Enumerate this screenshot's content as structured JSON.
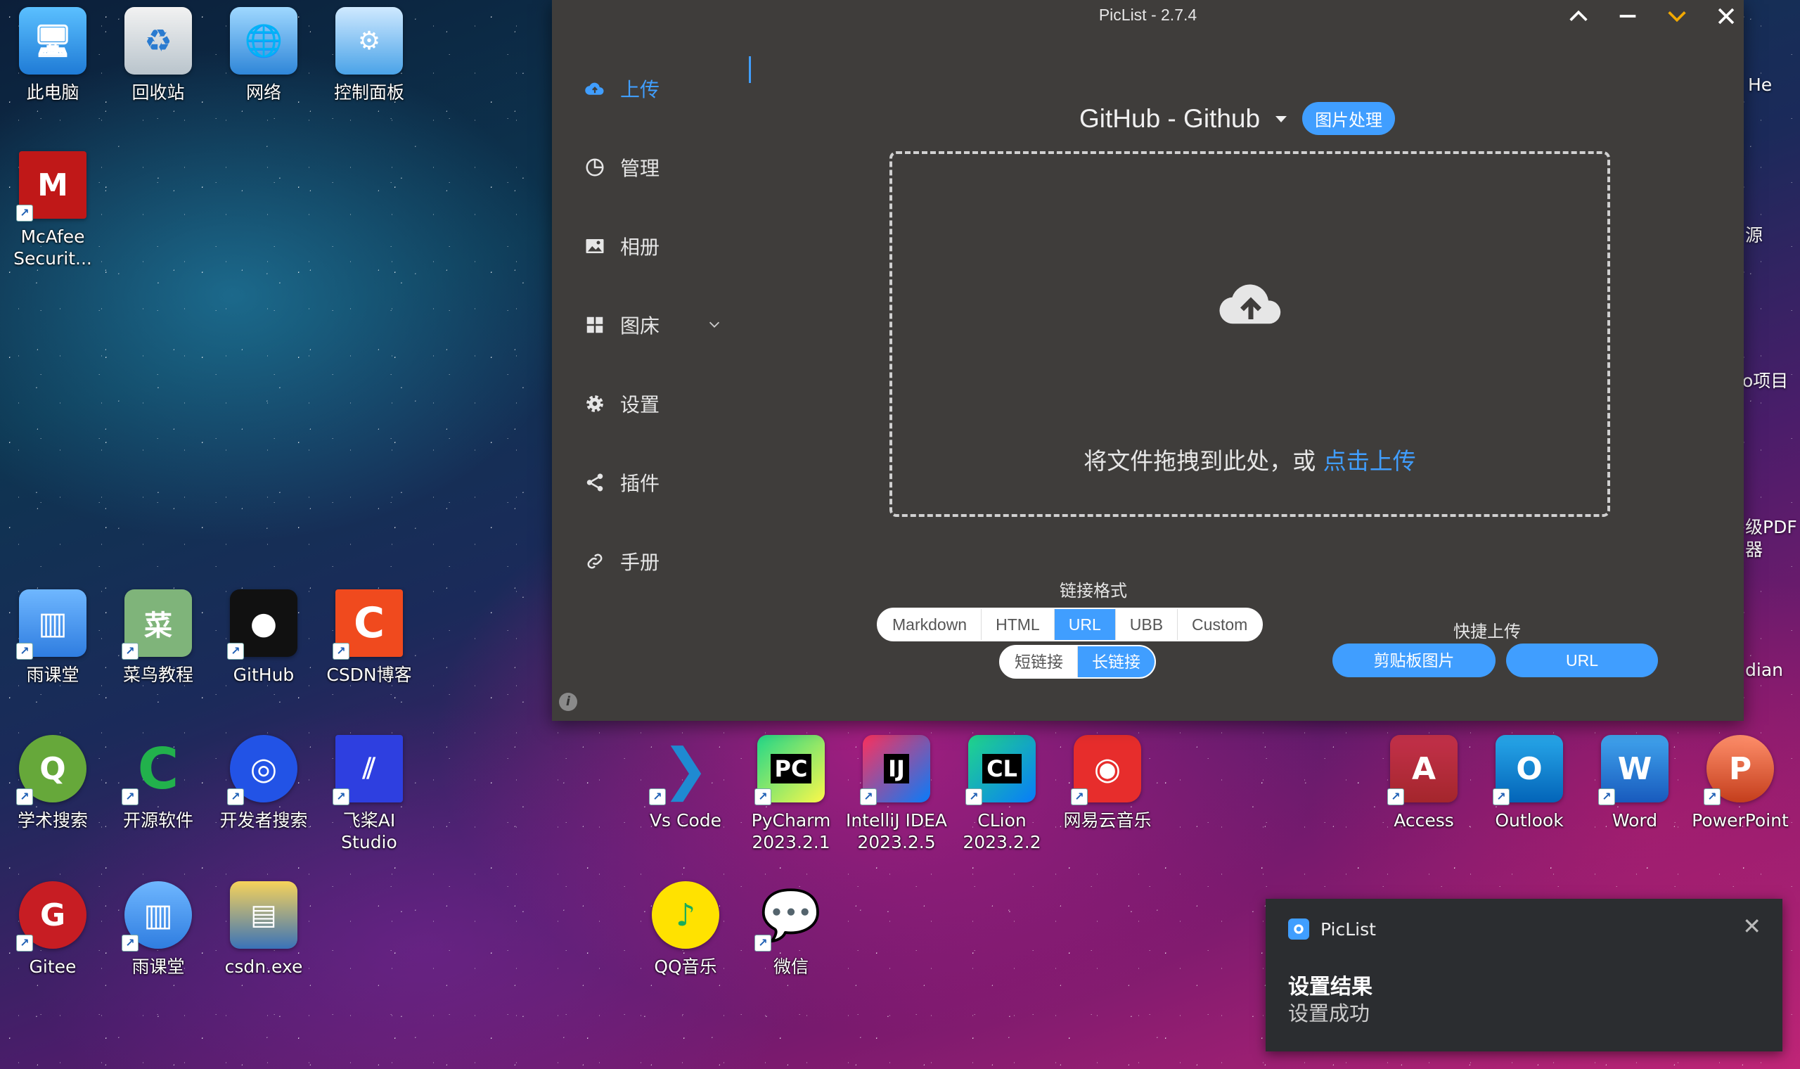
{
  "window": {
    "title": "PicList - 2.7.4",
    "controls": {
      "collapse": "^",
      "minimize": "—",
      "pin": "v",
      "close": "✕"
    }
  },
  "sidebar": {
    "items": [
      {
        "label": "上传",
        "icon": "cloud-upload-icon",
        "active": true
      },
      {
        "label": "管理",
        "icon": "pie-chart-icon"
      },
      {
        "label": "相册",
        "icon": "image-icon"
      },
      {
        "label": "图床",
        "icon": "grid-icon"
      },
      {
        "label": "设置",
        "icon": "gear-icon"
      },
      {
        "label": "插件",
        "icon": "share-icon"
      },
      {
        "label": "手册",
        "icon": "link-icon"
      }
    ]
  },
  "main": {
    "picbed": "GitHub - Github",
    "image_process_button": "图片处理",
    "drop_text": "将文件拖拽到此处，或 ",
    "drop_link": "点击上传",
    "link_format_title": "链接格式",
    "formats": [
      "Markdown",
      "HTML",
      "URL",
      "UBB",
      "Custom"
    ],
    "selected_format": "URL",
    "link_lengths": [
      "短链接",
      "长链接"
    ],
    "selected_length": "长链接",
    "quick_upload_title": "快捷上传",
    "quick_buttons": [
      "剪贴板图片",
      "URL"
    ]
  },
  "desktop": {
    "icons": [
      {
        "label": "此电脑"
      },
      {
        "label": "回收站"
      },
      {
        "label": "网络"
      },
      {
        "label": "控制面板"
      },
      {
        "label": "McAfee\nSecurit..."
      },
      {
        "label": "雨课堂"
      },
      {
        "label": "菜鸟教程"
      },
      {
        "label": "GitHub"
      },
      {
        "label": "CSDN博客"
      },
      {
        "label": "学术搜索"
      },
      {
        "label": "开源软件"
      },
      {
        "label": "开发者搜索"
      },
      {
        "label": "飞桨AI\nStudio"
      },
      {
        "label": "Gitee"
      },
      {
        "label": "雨课堂"
      },
      {
        "label": "csdn.exe"
      },
      {
        "label": "Vs Code"
      },
      {
        "label": "PyCharm\n2023.2.1"
      },
      {
        "label": "IntelliJ IDEA\n2023.2.5"
      },
      {
        "label": "CLion\n2023.2.2"
      },
      {
        "label": "网易云音乐"
      },
      {
        "label": "QQ音乐"
      },
      {
        "label": "微信"
      },
      {
        "label": "Access"
      },
      {
        "label": "Outlook"
      },
      {
        "label": "Word"
      },
      {
        "label": "PowerPoint"
      }
    ],
    "partial_labels": [
      "He",
      "源",
      "o项目",
      "级PDF",
      "器",
      "dian"
    ]
  },
  "notification": {
    "app": "PicList",
    "title": "设置结果",
    "body": "设置成功",
    "close": "✕"
  },
  "colors": {
    "accent": "#409eff",
    "window_bg": "#3f3d3b",
    "pin_color": "#f2a900"
  }
}
